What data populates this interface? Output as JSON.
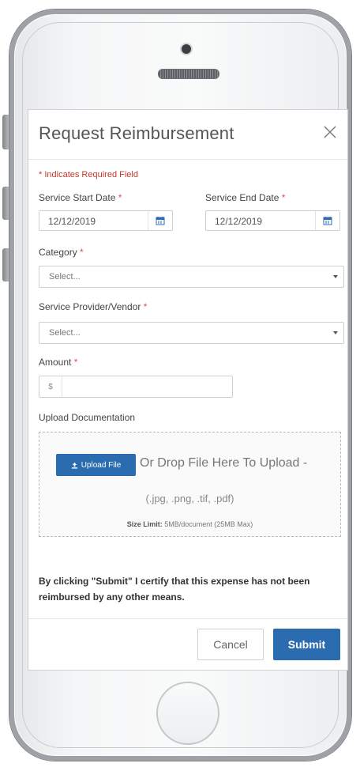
{
  "modal": {
    "title": "Request Reimbursement"
  },
  "form": {
    "required_note": "* Indicates Required Field",
    "required_mark": "*",
    "service_start": {
      "label": "Service Start Date",
      "value": "12/12/2019"
    },
    "service_end": {
      "label": "Service End Date",
      "value": "12/12/2019"
    },
    "category": {
      "label": "Category",
      "selected": "Select..."
    },
    "vendor": {
      "label": "Service Provider/Vendor",
      "selected": "Select..."
    },
    "amount": {
      "label": "Amount",
      "currency_symbol": "$",
      "value": ""
    },
    "upload": {
      "label": "Upload Documentation",
      "button_label": "Upload File",
      "drop_text": "Or Drop File Here To Upload -",
      "formats": "(.jpg, .png, .tif, .pdf)",
      "size_limit_label": "Size Limit:",
      "size_limit_value": "5MB/document (25MB Max)"
    },
    "certify_text": "By clicking \"Submit\" I certify that this expense has not been reimbursed by any other means."
  },
  "footer": {
    "cancel_label": "Cancel",
    "submit_label": "Submit"
  },
  "colors": {
    "primary": "#2b6cb0",
    "required": "#d9534f"
  },
  "icons": {
    "close": "close-icon",
    "calendar": "calendar-icon",
    "upload": "upload-icon",
    "caret": "caret-down-icon"
  }
}
